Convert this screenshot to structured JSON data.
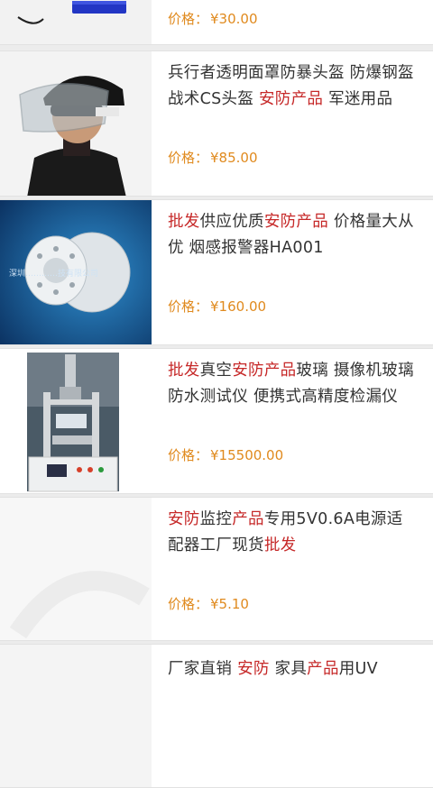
{
  "products": [
    {
      "title_parts": [],
      "price_label": "价格：",
      "price_value": "¥30.00",
      "image": "blue-device-thumbnail"
    },
    {
      "title_parts": [
        {
          "text": "兵行者透明面罩防暴头盔 防爆钢盔战术CS头盔 ",
          "hl": false
        },
        {
          "text": "安防产品",
          "hl": true
        },
        {
          "text": " 军迷用品",
          "hl": false
        }
      ],
      "price_label": "价格：",
      "price_value": "¥85.00",
      "image": "riot-helmet-photo"
    },
    {
      "title_parts": [
        {
          "text": "批发",
          "hl": true
        },
        {
          "text": "供应优质",
          "hl": false
        },
        {
          "text": "安防产品",
          "hl": true
        },
        {
          "text": " 价格量大从优 烟感报警器HA001",
          "hl": false
        }
      ],
      "price_label": "价格：",
      "price_value": "¥160.00",
      "image": "smoke-detector-photo",
      "watermark": "深圳…………技有限公司"
    },
    {
      "title_parts": [
        {
          "text": "批发",
          "hl": true
        },
        {
          "text": "真空",
          "hl": false
        },
        {
          "text": "安防产品",
          "hl": true
        },
        {
          "text": "玻璃 摄像机玻璃防水测试仪 便携式高精度检漏仪",
          "hl": false
        }
      ],
      "price_label": "价格：",
      "price_value": "¥15500.00",
      "image": "leak-tester-machine-photo"
    },
    {
      "title_parts": [
        {
          "text": "安防",
          "hl": true
        },
        {
          "text": "监控",
          "hl": false
        },
        {
          "text": "产品",
          "hl": true
        },
        {
          "text": "专用5V0.6A电源适配器工厂现货",
          "hl": false
        },
        {
          "text": "批发",
          "hl": true
        }
      ],
      "price_label": "价格：",
      "price_value": "¥5.10",
      "image": "power-adapter-photo"
    },
    {
      "title_parts": [
        {
          "text": "厂家直销 ",
          "hl": false
        },
        {
          "text": "安防",
          "hl": true
        },
        {
          "text": " 家具",
          "hl": false
        },
        {
          "text": "产品",
          "hl": true
        },
        {
          "text": "用UV",
          "hl": false
        }
      ],
      "price_label": "",
      "price_value": "",
      "image": "product-photo"
    }
  ],
  "colors": {
    "highlight": "#c62828",
    "price": "#e08a1e",
    "text": "#333333",
    "background": "#ececec"
  }
}
